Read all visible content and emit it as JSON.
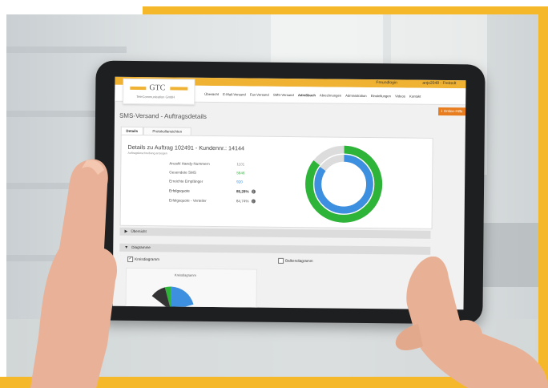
{
  "topbar": {
    "user_left": "Freundlogin",
    "user_right": "anjo2048 - Freitedt"
  },
  "logo": {
    "text": "GTC",
    "subtitle": "TeleCommunication GmbH"
  },
  "menu": {
    "items": [
      "Übersicht",
      "E-Mail-Versand",
      "Fax-Versand",
      "SMS-Versand",
      "Adreßbuch",
      "Abrechnungen",
      "Administration",
      "Einstellungen",
      "Videos",
      "Kontakt"
    ]
  },
  "online_help": {
    "label": "Online-Hilfe"
  },
  "page": {
    "title": "SMS-Versand - Auftragsdetails"
  },
  "tabs": [
    {
      "label": "Details"
    },
    {
      "label": "Protokollansichten"
    }
  ],
  "details": {
    "title": "Details zu Auftrag 102491 - Kundennr.: 14144",
    "subtitle": "Auftragsbeschreibung anzeigen",
    "rows": [
      {
        "label": "Anzahl Handy-Nummern",
        "value": "1101"
      },
      {
        "label": "Gesendete SMS",
        "value": "5846"
      },
      {
        "label": "Erreichte Empfänger",
        "value": "920"
      },
      {
        "label": "Erfolgsquote",
        "value": "85,28%"
      },
      {
        "label": "Erfolgsquote - Verteiler",
        "value": "84,74%"
      }
    ],
    "colors": {
      "sent": "#3fb950",
      "reached": "#3b8fd8",
      "neutral": "#9aa0a6"
    }
  },
  "donut": {
    "outer_fraction": 0.853,
    "inner_fraction": 0.847,
    "outer_color": "#2fb43a",
    "inner_color": "#3d8fdf",
    "rest_color": "#dcdcdc"
  },
  "sections": {
    "overview": "Übersicht",
    "diagrams": "Diagramme"
  },
  "checkboxes": {
    "pie": "Kreisdiagramm",
    "bar": "Balkendiagramm"
  },
  "mini_chart": {
    "title": "Kreisdiagramm"
  }
}
